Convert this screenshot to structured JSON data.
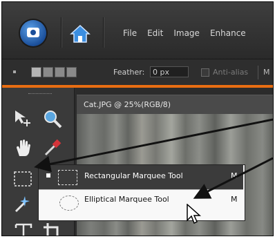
{
  "app": {
    "camera_icon": "camera-icon",
    "home_icon": "home-icon"
  },
  "menu": [
    "File",
    "Edit",
    "Image",
    "Enhance"
  ],
  "options_bar": {
    "feather_label": "Feather:",
    "feather_value": "0 px",
    "anti_alias_label": "Anti-alias",
    "mode_text": "M"
  },
  "document": {
    "tab_title": "Cat.JPG @ 25%(RGB/8)"
  },
  "tools": [
    {
      "name": "move-tool-icon"
    },
    {
      "name": "zoom-tool-icon"
    },
    {
      "name": "hand-tool-icon"
    },
    {
      "name": "eyedropper-tool-icon"
    },
    {
      "name": "rectangular-marquee-tool-icon"
    },
    {
      "name": "magic-wand-tool-icon"
    },
    {
      "name": "type-tool-icon"
    },
    {
      "name": "crop-tool-icon"
    }
  ],
  "flyout": {
    "items": [
      {
        "label": "Rectangular Marquee Tool",
        "shortcut": "M",
        "selected": true
      },
      {
        "label": "Elliptical Marquee Tool",
        "shortcut": "M",
        "selected": false
      }
    ]
  },
  "colors": {
    "accent_bar": "#e86d12",
    "arrow": "#111111"
  }
}
